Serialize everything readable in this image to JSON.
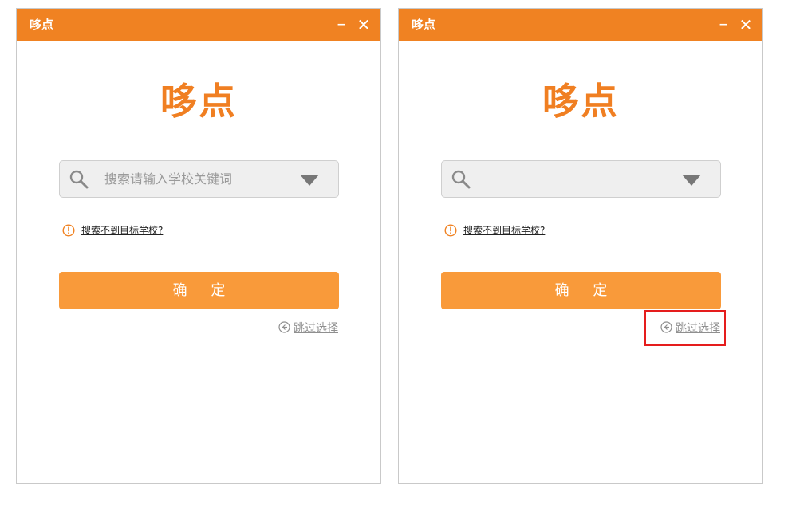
{
  "windows": [
    {
      "title": "哆点",
      "minimize_glyph": "–",
      "close_glyph": "✕",
      "logo": "哆点",
      "search": {
        "placeholder": "搜索请输入学校关键词",
        "value": ""
      },
      "not_found_link": "搜索不到目标学校?",
      "confirm_label": "确 定",
      "skip_label": "跳过选择"
    },
    {
      "title": "哆点",
      "minimize_glyph": "–",
      "close_glyph": "✕",
      "logo": "哆点",
      "search": {
        "placeholder": "",
        "value": ""
      },
      "not_found_link": "搜索不到目标学校?",
      "confirm_label": "确 定",
      "skip_label": "跳过选择"
    }
  ],
  "colors": {
    "titlebar": "#f08222",
    "logo": "#f07f22",
    "confirm_button": "#f99a3a",
    "highlight": "#e51d1d"
  },
  "icons": [
    "search-icon",
    "dropdown-triangle-icon",
    "warning-circle-icon",
    "back-arrow-circle-icon"
  ]
}
